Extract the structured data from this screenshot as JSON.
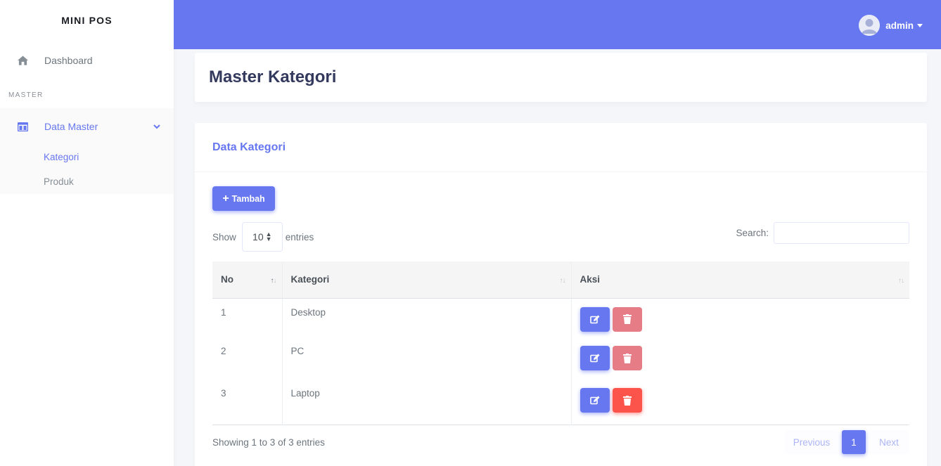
{
  "brand": "MINI POS",
  "sidebar": {
    "dashboard_label": "Dashboard",
    "menu_header": "MASTER",
    "data_master_label": "Data Master",
    "sub_items": [
      "Kategori",
      "Produk"
    ]
  },
  "navbar": {
    "username": "admin"
  },
  "page": {
    "title": "Master Kategori"
  },
  "card": {
    "title": "Data Kategori",
    "add_button": "Tambah",
    "show_label": "Show",
    "entries_value": "10",
    "entries_label": "entries",
    "search_label": "Search:",
    "search_value": ""
  },
  "table": {
    "headers": [
      "No",
      "Kategori",
      "Aksi"
    ],
    "rows": [
      {
        "no": "1",
        "kategori": "Desktop"
      },
      {
        "no": "2",
        "kategori": "PC"
      },
      {
        "no": "3",
        "kategori": "Laptop"
      }
    ]
  },
  "footer": {
    "info": "Showing 1 to 3 of 3 entries",
    "prev": "Previous",
    "page": "1",
    "next": "Next"
  },
  "colors": {
    "primary": "#6777ef",
    "danger": "#fc544b",
    "danger_light": "#e57c86"
  },
  "icons": [
    "home-icon",
    "columns-icon",
    "chevron-down-icon",
    "plus-icon",
    "edit-icon",
    "trash-icon",
    "avatar-icon"
  ]
}
